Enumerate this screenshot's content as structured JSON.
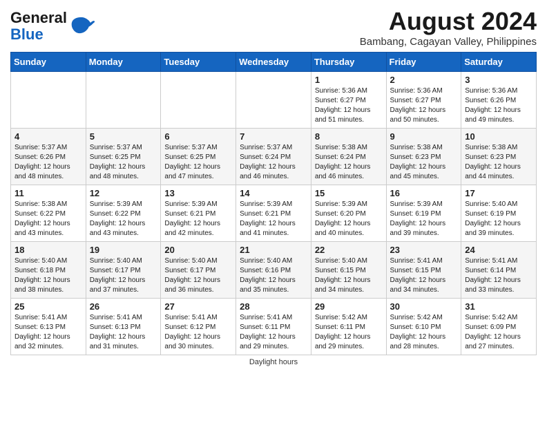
{
  "logo": {
    "line1": "General",
    "line2": "Blue"
  },
  "title": "August 2024",
  "location": "Bambang, Cagayan Valley, Philippines",
  "days_of_week": [
    "Sunday",
    "Monday",
    "Tuesday",
    "Wednesday",
    "Thursday",
    "Friday",
    "Saturday"
  ],
  "weeks": [
    [
      {
        "day": "",
        "content": ""
      },
      {
        "day": "",
        "content": ""
      },
      {
        "day": "",
        "content": ""
      },
      {
        "day": "",
        "content": ""
      },
      {
        "day": "1",
        "content": "Sunrise: 5:36 AM\nSunset: 6:27 PM\nDaylight: 12 hours\nand 51 minutes."
      },
      {
        "day": "2",
        "content": "Sunrise: 5:36 AM\nSunset: 6:27 PM\nDaylight: 12 hours\nand 50 minutes."
      },
      {
        "day": "3",
        "content": "Sunrise: 5:36 AM\nSunset: 6:26 PM\nDaylight: 12 hours\nand 49 minutes."
      }
    ],
    [
      {
        "day": "4",
        "content": "Sunrise: 5:37 AM\nSunset: 6:26 PM\nDaylight: 12 hours\nand 48 minutes."
      },
      {
        "day": "5",
        "content": "Sunrise: 5:37 AM\nSunset: 6:25 PM\nDaylight: 12 hours\nand 48 minutes."
      },
      {
        "day": "6",
        "content": "Sunrise: 5:37 AM\nSunset: 6:25 PM\nDaylight: 12 hours\nand 47 minutes."
      },
      {
        "day": "7",
        "content": "Sunrise: 5:37 AM\nSunset: 6:24 PM\nDaylight: 12 hours\nand 46 minutes."
      },
      {
        "day": "8",
        "content": "Sunrise: 5:38 AM\nSunset: 6:24 PM\nDaylight: 12 hours\nand 46 minutes."
      },
      {
        "day": "9",
        "content": "Sunrise: 5:38 AM\nSunset: 6:23 PM\nDaylight: 12 hours\nand 45 minutes."
      },
      {
        "day": "10",
        "content": "Sunrise: 5:38 AM\nSunset: 6:23 PM\nDaylight: 12 hours\nand 44 minutes."
      }
    ],
    [
      {
        "day": "11",
        "content": "Sunrise: 5:38 AM\nSunset: 6:22 PM\nDaylight: 12 hours\nand 43 minutes."
      },
      {
        "day": "12",
        "content": "Sunrise: 5:39 AM\nSunset: 6:22 PM\nDaylight: 12 hours\nand 43 minutes."
      },
      {
        "day": "13",
        "content": "Sunrise: 5:39 AM\nSunset: 6:21 PM\nDaylight: 12 hours\nand 42 minutes."
      },
      {
        "day": "14",
        "content": "Sunrise: 5:39 AM\nSunset: 6:21 PM\nDaylight: 12 hours\nand 41 minutes."
      },
      {
        "day": "15",
        "content": "Sunrise: 5:39 AM\nSunset: 6:20 PM\nDaylight: 12 hours\nand 40 minutes."
      },
      {
        "day": "16",
        "content": "Sunrise: 5:39 AM\nSunset: 6:19 PM\nDaylight: 12 hours\nand 39 minutes."
      },
      {
        "day": "17",
        "content": "Sunrise: 5:40 AM\nSunset: 6:19 PM\nDaylight: 12 hours\nand 39 minutes."
      }
    ],
    [
      {
        "day": "18",
        "content": "Sunrise: 5:40 AM\nSunset: 6:18 PM\nDaylight: 12 hours\nand 38 minutes."
      },
      {
        "day": "19",
        "content": "Sunrise: 5:40 AM\nSunset: 6:17 PM\nDaylight: 12 hours\nand 37 minutes."
      },
      {
        "day": "20",
        "content": "Sunrise: 5:40 AM\nSunset: 6:17 PM\nDaylight: 12 hours\nand 36 minutes."
      },
      {
        "day": "21",
        "content": "Sunrise: 5:40 AM\nSunset: 6:16 PM\nDaylight: 12 hours\nand 35 minutes."
      },
      {
        "day": "22",
        "content": "Sunrise: 5:40 AM\nSunset: 6:15 PM\nDaylight: 12 hours\nand 34 minutes."
      },
      {
        "day": "23",
        "content": "Sunrise: 5:41 AM\nSunset: 6:15 PM\nDaylight: 12 hours\nand 34 minutes."
      },
      {
        "day": "24",
        "content": "Sunrise: 5:41 AM\nSunset: 6:14 PM\nDaylight: 12 hours\nand 33 minutes."
      }
    ],
    [
      {
        "day": "25",
        "content": "Sunrise: 5:41 AM\nSunset: 6:13 PM\nDaylight: 12 hours\nand 32 minutes."
      },
      {
        "day": "26",
        "content": "Sunrise: 5:41 AM\nSunset: 6:13 PM\nDaylight: 12 hours\nand 31 minutes."
      },
      {
        "day": "27",
        "content": "Sunrise: 5:41 AM\nSunset: 6:12 PM\nDaylight: 12 hours\nand 30 minutes."
      },
      {
        "day": "28",
        "content": "Sunrise: 5:41 AM\nSunset: 6:11 PM\nDaylight: 12 hours\nand 29 minutes."
      },
      {
        "day": "29",
        "content": "Sunrise: 5:42 AM\nSunset: 6:11 PM\nDaylight: 12 hours\nand 29 minutes."
      },
      {
        "day": "30",
        "content": "Sunrise: 5:42 AM\nSunset: 6:10 PM\nDaylight: 12 hours\nand 28 minutes."
      },
      {
        "day": "31",
        "content": "Sunrise: 5:42 AM\nSunset: 6:09 PM\nDaylight: 12 hours\nand 27 minutes."
      }
    ]
  ],
  "footer": "Daylight hours"
}
